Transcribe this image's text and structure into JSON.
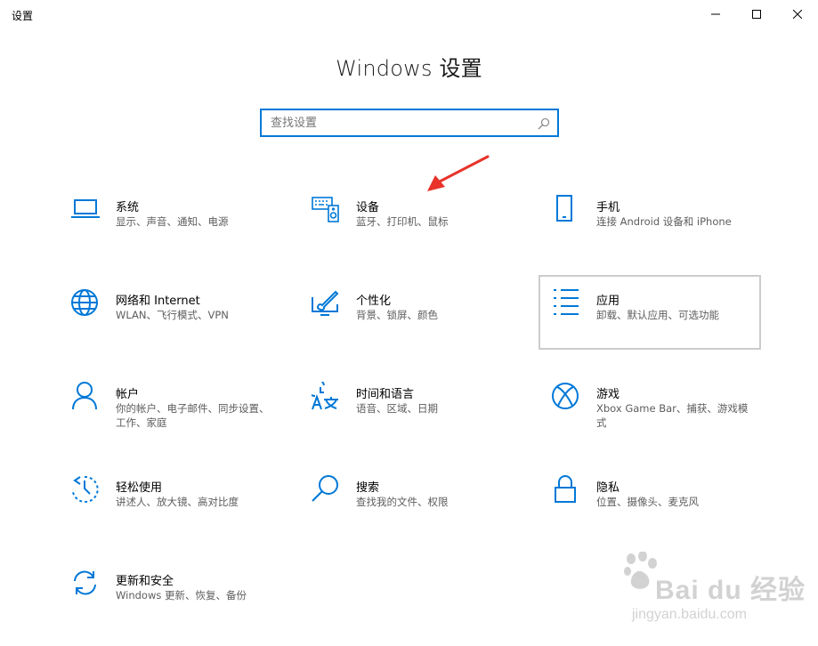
{
  "window": {
    "title": "设置",
    "minimize_icon": "minimize-icon",
    "maximize_icon": "maximize-icon",
    "close_icon": "close-icon"
  },
  "heading": "Windows 设置",
  "search": {
    "value": "",
    "placeholder": "查找设置",
    "icon": "search-icon"
  },
  "accent_color": "#0078d7",
  "annotation_arrow_color": "#e8322a",
  "tiles": [
    {
      "id": "system",
      "title": "系统",
      "desc": "显示、声音、通知、电源",
      "icon": "laptop-icon"
    },
    {
      "id": "devices",
      "title": "设备",
      "desc": "蓝牙、打印机、鼠标",
      "icon": "keyboard-speaker-icon"
    },
    {
      "id": "phone",
      "title": "手机",
      "desc": "连接 Android 设备和 iPhone",
      "icon": "phone-icon"
    },
    {
      "id": "network",
      "title": "网络和 Internet",
      "desc": "WLAN、飞行模式、VPN",
      "icon": "globe-icon"
    },
    {
      "id": "personalization",
      "title": "个性化",
      "desc": "背景、锁屏、颜色",
      "icon": "paint-brush-icon"
    },
    {
      "id": "apps",
      "title": "应用",
      "desc": "卸载、默认应用、可选功能",
      "icon": "app-list-icon",
      "selected": true
    },
    {
      "id": "accounts",
      "title": "帐户",
      "desc": "你的帐户、电子邮件、同步设置、工作、家庭",
      "icon": "person-icon"
    },
    {
      "id": "time-language",
      "title": "时间和语言",
      "desc": "语音、区域、日期",
      "icon": "time-language-icon"
    },
    {
      "id": "gaming",
      "title": "游戏",
      "desc": "Xbox Game Bar、捕获、游戏模式",
      "icon": "xbox-icon"
    },
    {
      "id": "ease-of-access",
      "title": "轻松使用",
      "desc": "讲述人、放大镜、高对比度",
      "icon": "ease-of-access-icon"
    },
    {
      "id": "search",
      "title": "搜索",
      "desc": "查找我的文件、权限",
      "icon": "magnifier-icon"
    },
    {
      "id": "privacy",
      "title": "隐私",
      "desc": "位置、摄像头、麦克风",
      "icon": "lock-icon"
    },
    {
      "id": "update-security",
      "title": "更新和安全",
      "desc": "Windows 更新、恢复、备份",
      "icon": "sync-icon"
    }
  ],
  "watermark": {
    "brand": "Bai du 经验",
    "url": "jingyan.baidu.com"
  }
}
